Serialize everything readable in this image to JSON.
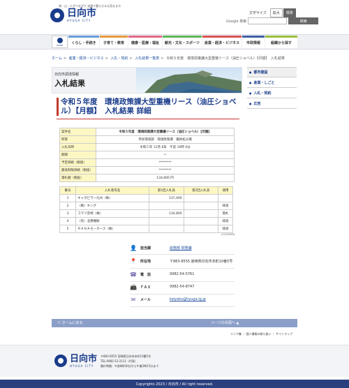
{
  "header": {
    "tagline": "海・山・人がつながり 笑顔で暮らせる元気なまち",
    "logo_jp": "日向市",
    "logo_en": "HYUGA CITY",
    "textsize_label": "文字サイズ",
    "textsize_large": "拡大",
    "textsize_normal": "標準",
    "search_label": "Google 検索",
    "search_placeholder": "",
    "search_button": "検索"
  },
  "nav": {
    "home_label": "HOME",
    "items": [
      {
        "label": "くらし・手続き",
        "color": "#6a9cd6"
      },
      {
        "label": "子育て・教育",
        "color": "#e89a3c"
      },
      {
        "label": "健康・医療・福祉",
        "color": "#e36a8a"
      },
      {
        "label": "観光・文化・スポーツ",
        "color": "#5cb85c"
      },
      {
        "label": "産業・経済・ビジネス",
        "color": "#d9534f"
      },
      {
        "label": "市政情報",
        "color": "#3f5fa8"
      },
      {
        "label": "組織から探す",
        "color": "#9ac03a"
      }
    ]
  },
  "breadcrumb": [
    "ホーム",
    "産業・経済・ビジネス",
    "入札・契約",
    "入札結果一覧表",
    "令和５年度　環境政策課大型重機リース（油圧ショベル）【月額】　入札結果"
  ],
  "banner": {
    "dept": "日向市調達情報",
    "title": "入札結果"
  },
  "sidebar": [
    "都市建設",
    "産業・しごと",
    "入札・契約",
    "広告"
  ],
  "title": "令和５年度　環境政策課大型重機リース（油圧ショベル）【月額】　入札結果 詳細",
  "detail": [
    {
      "label": "案件名",
      "value": "令和５年度　環境政策課大型重機リース（油圧ショベル）【月額】"
    },
    {
      "label": "所管",
      "value": "市民環境部　環境政策課　最終処分場"
    },
    {
      "label": "入札日時",
      "value": "令和５年 11月 8日　午前 10時 0分"
    },
    {
      "label": "期間",
      "value": "〜"
    },
    {
      "label": "予定価格（税抜）",
      "value": "********"
    },
    {
      "label": "最低制限価格（税抜）",
      "value": "********"
    },
    {
      "label": "落札額（税抜）",
      "value": "134,800 円"
    }
  ],
  "bidders": {
    "headers": [
      "番号",
      "入札者氏名",
      "第1回入札高",
      "第2回入札高",
      "適用"
    ],
    "rows": [
      {
        "no": "1",
        "name": "キャタピラー九州（株）",
        "first": "137,000",
        "second": "",
        "note": ""
      },
      {
        "no": "2",
        "name": "（株）キング",
        "first": "",
        "second": "",
        "note": "辞退"
      },
      {
        "no": "3",
        "name": "コマツ宮崎（株）",
        "first": "134,800",
        "second": "",
        "note": "落札"
      },
      {
        "no": "4",
        "name": "（有）北斎機販",
        "first": "",
        "second": "",
        "note": "辞退"
      },
      {
        "no": "5",
        "name": "ＲＡＮＡモータース（株）",
        "first": "",
        "second": "",
        "note": "辞退"
      }
    ],
    "note": "(1212/820)"
  },
  "contact": {
    "dept_label": "担当課",
    "dept_value": "総務部 財務課",
    "addr_label": "所在地",
    "addr_value": "〒883-8555 宮崎県日向市本町10番5号",
    "tel_label": "電　話",
    "tel_value": "0982-54-5761",
    "fax_label": "ＦＡＸ",
    "fax_value": "0982-54-8747",
    "mail_label": "メール",
    "mail_value": "keiyaku@hyuga.lg.jp"
  },
  "pagebar": {
    "back": "＜ ホームに戻る",
    "top": "ページの先頭へ ▲"
  },
  "footer_links": [
    "リンク集",
    "個人情報の取り扱い",
    "サイトマップ"
  ],
  "footer": {
    "logo_jp": "日向市",
    "logo_en": "HYUGA CITY",
    "addr1": "〒883-8555 宮崎県日向市本町10番5号",
    "addr2": "TEL:0982-52-2111（代表）",
    "addr3": "開庁時間：午前8時30分から午後5時15分まで"
  },
  "copyright": "Copyrights 2023 / 日向市 / All right reserved."
}
